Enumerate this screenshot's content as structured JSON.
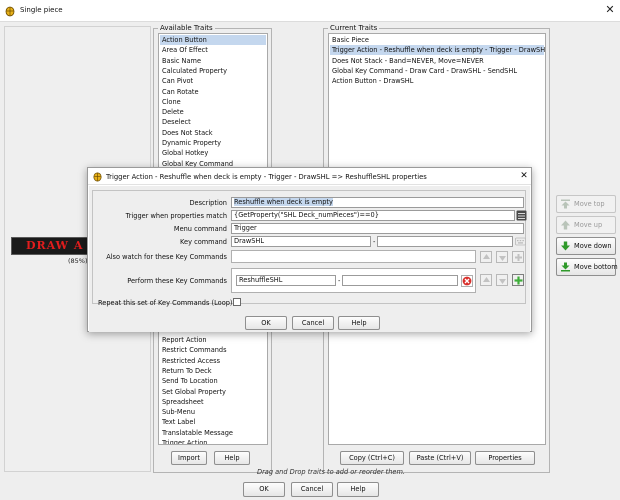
{
  "window": {
    "title": "Single piece",
    "close_glyph": "✕"
  },
  "preview": {
    "image_text": "DRAW A",
    "scale": "(85%)"
  },
  "available_traits": {
    "title": "Available Traits",
    "top_items": [
      "Action Button",
      "Area Of Effect",
      "Basic Name",
      "Calculated Property",
      "Can Pivot",
      "Can Rotate",
      "Clone",
      "Delete",
      "Deselect",
      "Does Not Stack",
      "Dynamic Property",
      "Global Hotkey",
      "Global Key Command"
    ],
    "bottom_items": [
      "Report Action",
      "Restrict Commands",
      "Restricted Access",
      "Return To Deck",
      "Send To Location",
      "Set Global Property",
      "Spreadsheet",
      "Sub-Menu",
      "Text Label",
      "Translatable Message",
      "Trigger Action"
    ],
    "selected_index": 0,
    "import_label": "Import",
    "help_label": "Help"
  },
  "current_traits": {
    "title": "Current Traits",
    "items": [
      "Basic Piece",
      "Trigger Action - Reshuffle when deck is empty - Trigger - DrawSHL => R",
      "Does Not Stack - Band=NEVER, Move=NEVER",
      "Global Key Command - Draw Card - DrawSHL - SendSHL",
      "Action Button - DrawSHL"
    ],
    "selected_index": 1,
    "copy_label": "Copy (Ctrl+C)",
    "paste_label": "Paste (Ctrl+V)",
    "properties_label": "Properties"
  },
  "move_buttons": {
    "top": "Move top",
    "up": "Move up",
    "down": "Move down",
    "bottom": "Move bottom"
  },
  "drag_hint": "Drag and Drop traits to add or reorder them.",
  "footer": {
    "ok": "OK",
    "cancel": "Cancel",
    "help": "Help"
  },
  "dialog": {
    "title": "Trigger Action - Reshuffle when deck is empty - Trigger - DrawSHL => ReshuffleSHL properties",
    "close_glyph": "✕",
    "labels": {
      "description": "Description",
      "match": "Trigger when properties match",
      "menu": "Menu command",
      "key": "Key command",
      "watch": "Also watch for these Key Commands",
      "perform": "Perform these Key Commands",
      "repeat": "Repeat this set of Key Commands (Loop)"
    },
    "values": {
      "description": "Reshuffle when deck is empty",
      "match": "{GetProperty(\"SHL Deck_numPieces\")==0}",
      "menu": "Trigger",
      "key": "DrawSHL",
      "key_separator": "-",
      "perform": "ReshuffleSHL",
      "perform_separator": "-"
    },
    "repeat_checked": false,
    "ok": "OK",
    "cancel": "Cancel",
    "help": "Help"
  },
  "colors": {
    "selection": "#c4d7ee",
    "delete_red": "#d9302c",
    "add_green": "#3fae3a"
  },
  "icons": [
    "app-icon",
    "close-icon",
    "move-top-icon",
    "move-up-icon",
    "move-down-icon",
    "move-bottom-icon",
    "edit-expression-icon",
    "keyboard-icon",
    "arrow-up-icon",
    "arrow-down-icon",
    "add-icon",
    "delete-icon"
  ]
}
